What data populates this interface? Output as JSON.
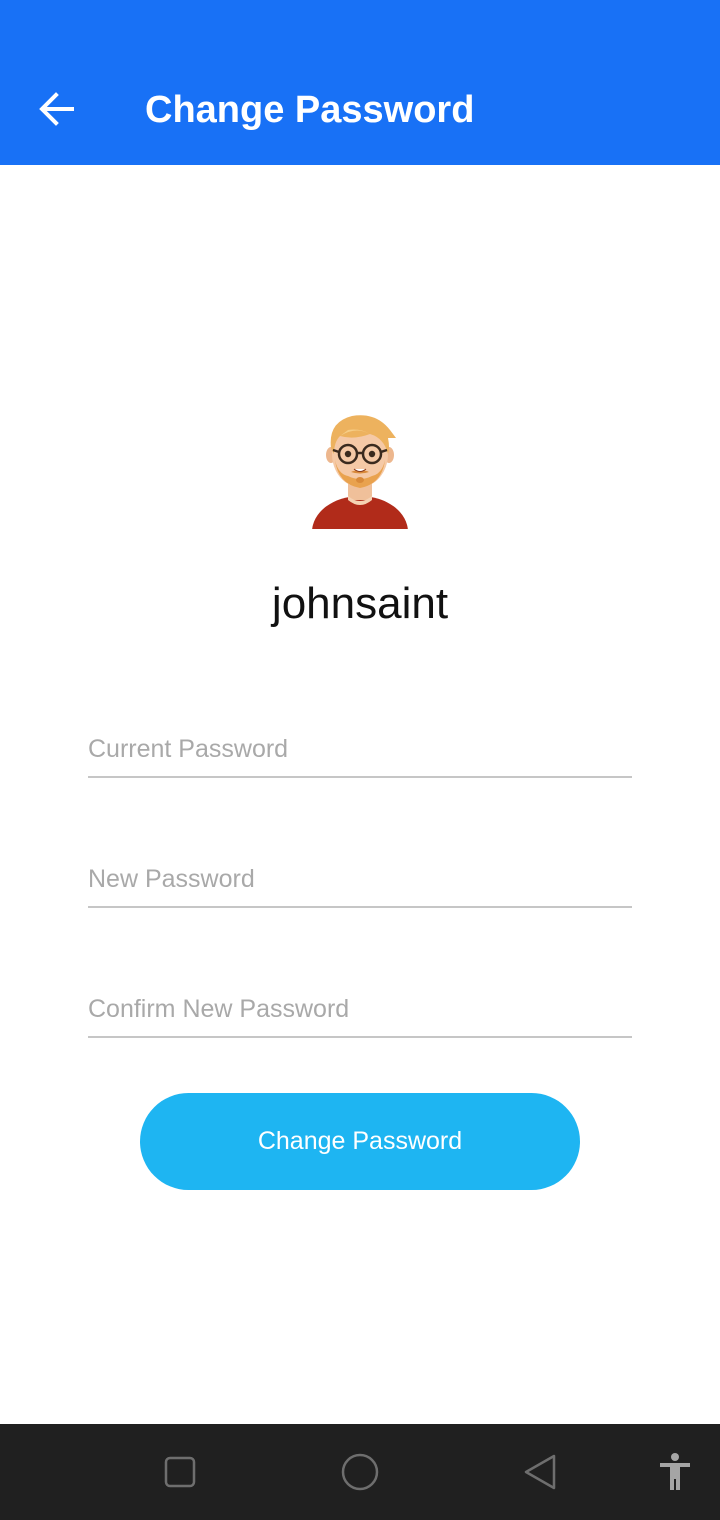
{
  "app_bar": {
    "title": "Change Password",
    "back_icon": "arrow-left-icon",
    "color": "#1871F6"
  },
  "profile": {
    "avatar": "user-avatar-illustration",
    "username": "johnsaint"
  },
  "form": {
    "current_password": {
      "placeholder": "Current Password",
      "value": ""
    },
    "new_password": {
      "placeholder": "New Password",
      "value": ""
    },
    "confirm_password": {
      "placeholder": "Confirm New Password",
      "value": ""
    },
    "submit_label": "Change Password",
    "button_color": "#1EB5F2"
  },
  "system_nav": {
    "icons": [
      "recents-square-icon",
      "home-circle-icon",
      "back-triangle-icon",
      "accessibility-icon"
    ],
    "color": "#202020"
  }
}
